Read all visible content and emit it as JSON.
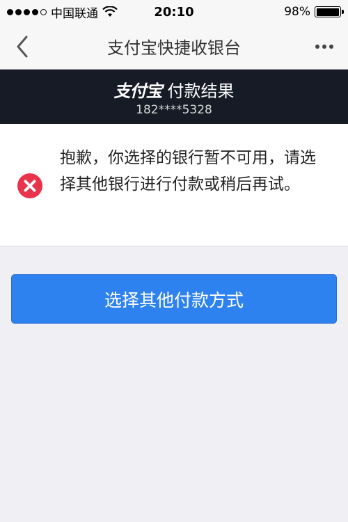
{
  "status_bar": {
    "carrier": "中国联通",
    "time": "20:10",
    "battery_percent_label": "98%",
    "battery_level": 0.98,
    "signal_dots_filled": 4,
    "signal_dots_total": 5
  },
  "nav": {
    "title": "支付宝快捷收银台",
    "back_icon": "chevron-left-icon",
    "more_icon": "more-dots-icon"
  },
  "brand": {
    "logo_text": "支付宝",
    "title": "付款结果",
    "phone": "182****5328"
  },
  "message": {
    "icon": "error-circle-icon",
    "text": "抱歉，你选择的银行暂不可用，请选择其他银行进行付款或稍后再试。"
  },
  "actions": {
    "primary_label": "选择其他付款方式"
  },
  "colors": {
    "primary_button": "#2e82ef",
    "brand_band": "#161b26",
    "error_icon": "#e8334a",
    "background": "#efeff4"
  }
}
